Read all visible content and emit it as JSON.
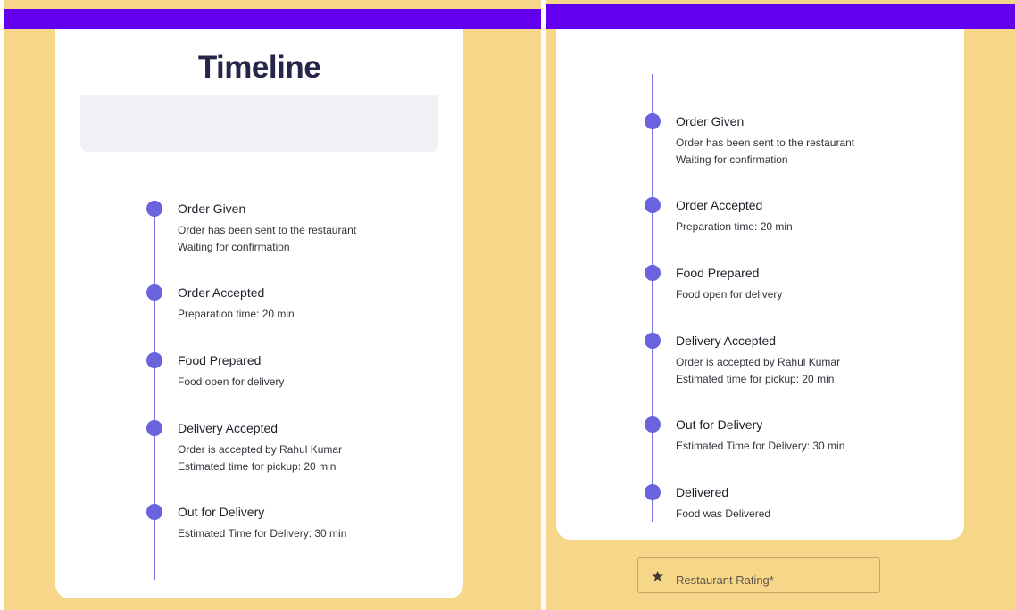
{
  "left_panel": {
    "title": "Timeline",
    "timeline": [
      {
        "title": "Order Given",
        "lines": [
          "Order has been sent to the restaurant",
          "Waiting for confirmation"
        ]
      },
      {
        "title": "Order Accepted",
        "lines": [
          "Preparation time: 20 min"
        ]
      },
      {
        "title": "Food Prepared",
        "lines": [
          "Food open for delivery"
        ]
      },
      {
        "title": "Delivery Accepted",
        "lines": [
          "Order is accepted by Rahul Kumar",
          "Estimated time for pickup: 20 min"
        ]
      },
      {
        "title": "Out for Delivery",
        "lines": [
          "Estimated Time for Delivery: 30 min"
        ]
      }
    ]
  },
  "right_panel": {
    "timeline": [
      {
        "title": "Order Given",
        "lines": [
          "Order has been sent to the restaurant",
          "Waiting for confirmation"
        ]
      },
      {
        "title": "Order Accepted",
        "lines": [
          "Preparation time: 20 min"
        ]
      },
      {
        "title": "Food Prepared",
        "lines": [
          "Food open for delivery"
        ]
      },
      {
        "title": "Delivery Accepted",
        "lines": [
          "Order is accepted by Rahul Kumar",
          "Estimated time for pickup: 20 min"
        ]
      },
      {
        "title": "Out for Delivery",
        "lines": [
          "Estimated Time for Delivery: 30 min"
        ]
      },
      {
        "title": "Delivered",
        "lines": [
          "Food was Delivered"
        ]
      }
    ],
    "rating_button": {
      "label": "Restaurant Rating*",
      "icon": "star-icon"
    }
  },
  "colors": {
    "background": "#f6d78a",
    "topbar": "#6200ee",
    "timeline_accent": "#6a63dd"
  }
}
